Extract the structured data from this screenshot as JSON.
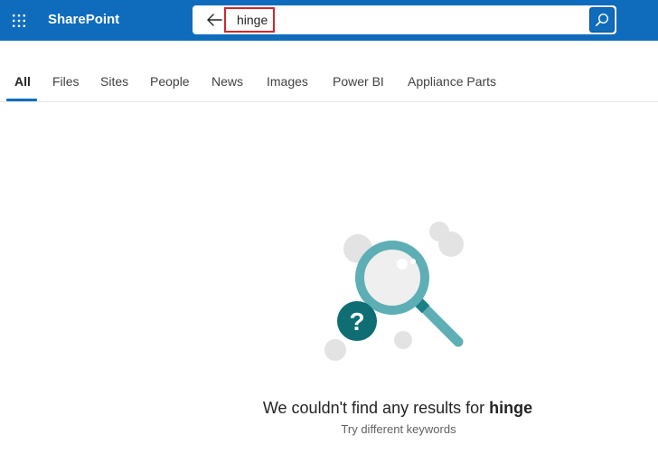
{
  "suite": {
    "app_name": "SharePoint",
    "brand_color": "#0f6cbd"
  },
  "search": {
    "query": "hinge",
    "back_icon": "arrow-left-icon",
    "submit_icon": "search-icon"
  },
  "tabs": [
    {
      "label": "All",
      "active": true
    },
    {
      "label": "Files"
    },
    {
      "label": "Sites"
    },
    {
      "label": "People"
    },
    {
      "label": "News"
    },
    {
      "label": "Images"
    },
    {
      "label": "Power BI"
    },
    {
      "label": "Appliance Parts"
    }
  ],
  "empty_state": {
    "title_prefix": "We couldn't find any results for ",
    "title_query": "hinge",
    "subtitle": "Try different keywords",
    "illustration": "magnifier-question-illustration"
  }
}
